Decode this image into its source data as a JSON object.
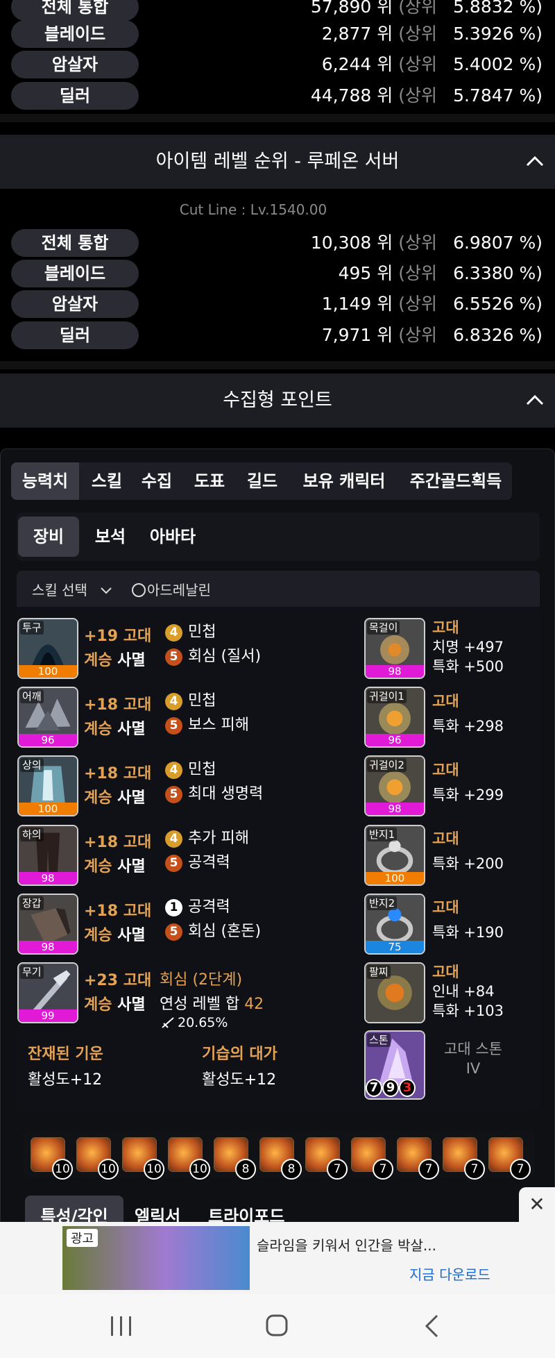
{
  "top_ranks": [
    {
      "label": "전체 통합",
      "rank": "57,890 위",
      "sang": "(상위",
      "pct": "5.8832 %)"
    },
    {
      "label": "블레이드",
      "rank": "2,877 위",
      "sang": "(상위",
      "pct": "5.3926 %)"
    },
    {
      "label": "암살자",
      "rank": "6,244 위",
      "sang": "(상위",
      "pct": "5.4002 %)"
    },
    {
      "label": "딜러",
      "rank": "44,788 위",
      "sang": "(상위",
      "pct": "5.7847 %)"
    }
  ],
  "item_level_section": {
    "title": "아이템 레벨 순위 - 루페온 서버",
    "cutline": "Cut Line : Lv.1540.00"
  },
  "item_ranks": [
    {
      "label": "전체 통합",
      "rank": "10,308 위",
      "sang": "(상위",
      "pct": "6.9807 %)"
    },
    {
      "label": "블레이드",
      "rank": "495 위",
      "sang": "(상위",
      "pct": "6.3380 %)"
    },
    {
      "label": "암살자",
      "rank": "1,149 위",
      "sang": "(상위",
      "pct": "6.5526 %)"
    },
    {
      "label": "딜러",
      "rank": "7,971 위",
      "sang": "(상위",
      "pct": "6.8326 %)"
    }
  ],
  "collect_section": {
    "title": "수집형 포인트"
  },
  "tabs": [
    "능력치",
    "스킬",
    "수집",
    "도표",
    "길드",
    "보유 캐릭터",
    "주간골드획득"
  ],
  "subtabs": [
    "장비",
    "보석",
    "아바타"
  ],
  "skill_select": {
    "label": "스킬 선택",
    "option": "아드레날린"
  },
  "equipment": [
    {
      "slot": "투구",
      "quality": "100",
      "qcolor": "#f07d00",
      "upgrade": "+19 고대",
      "set": "계승",
      "setname": "사멸",
      "eng1_lv": "4",
      "eng1": "민첩",
      "eng2_lv": "5",
      "eng2": "회심 (질서)"
    },
    {
      "slot": "어깨",
      "quality": "96",
      "qcolor": "#e01ad6",
      "upgrade": "+18 고대",
      "set": "계승",
      "setname": "사멸",
      "eng1_lv": "4",
      "eng1": "민첩",
      "eng2_lv": "5",
      "eng2": "보스 피해"
    },
    {
      "slot": "상의",
      "quality": "100",
      "qcolor": "#f07d00",
      "upgrade": "+18 고대",
      "set": "계승",
      "setname": "사멸",
      "eng1_lv": "4",
      "eng1": "민첩",
      "eng2_lv": "5",
      "eng2": "최대 생명력"
    },
    {
      "slot": "하의",
      "quality": "98",
      "qcolor": "#e01ad6",
      "upgrade": "+18 고대",
      "set": "계승",
      "setname": "사멸",
      "eng1_lv": "4",
      "eng1": "추가 피해",
      "eng2_lv": "5",
      "eng2": "공격력"
    },
    {
      "slot": "장갑",
      "quality": "98",
      "qcolor": "#e01ad6",
      "upgrade": "+18 고대",
      "set": "계승",
      "setname": "사멸",
      "eng1_lv": "1",
      "eng1": "공격력",
      "eng2_lv": "5",
      "eng2": "회심 (혼돈)"
    }
  ],
  "weapon": {
    "slot": "무기",
    "quality": "99",
    "upgrade": "+23 고대",
    "set": "계승",
    "setname": "사멸",
    "effect": "회심 (2단계)",
    "bond_label": "연성 레벨 합",
    "bond_value": "42",
    "dmg": "20.65%"
  },
  "set_effects": [
    {
      "name": "잔재된 기운",
      "value": "활성도+12"
    },
    {
      "name": "기습의 대가",
      "value": "활성도+12"
    }
  ],
  "accessories": [
    {
      "slot": "목걸이",
      "quality": "98",
      "qcolor": "#e01ad6",
      "grade": "고대",
      "lines": [
        "치명 +497",
        "특화 +500"
      ]
    },
    {
      "slot": "귀걸이1",
      "quality": "96",
      "qcolor": "#e01ad6",
      "grade": "고대",
      "lines": [
        "특화 +298"
      ]
    },
    {
      "slot": "귀걸이2",
      "quality": "98",
      "qcolor": "#e01ad6",
      "grade": "고대",
      "lines": [
        "특화 +299"
      ]
    },
    {
      "slot": "반지1",
      "quality": "100",
      "qcolor": "#f07d00",
      "grade": "고대",
      "lines": [
        "특화 +200"
      ]
    },
    {
      "slot": "반지2",
      "quality": "75",
      "qcolor": "#1a86e0",
      "grade": "고대",
      "lines": [
        "특화 +190"
      ]
    },
    {
      "slot": "팔찌",
      "quality": "",
      "qcolor": "",
      "grade": "고대",
      "lines": [
        "인내 +84",
        "특화 +103"
      ]
    }
  ],
  "stone": {
    "slot": "스톤",
    "name": "고대 스톤",
    "tier": "IV",
    "n1": "7",
    "n2": "9",
    "n3": "3"
  },
  "gems": [
    "10",
    "10",
    "10",
    "10",
    "8",
    "8",
    "7",
    "7",
    "7",
    "7",
    "7"
  ],
  "bottom_tabs": [
    "특성/각인",
    "엘릭서",
    "트라이포드"
  ],
  "ad": {
    "badge": "광고",
    "text": "슬라임을 키워서 인간을 박살...",
    "cta": "지금 다운로드",
    "close": "✕"
  },
  "colors": {
    "accent": "#e3a254",
    "bg": "#000000",
    "panel": "#1d1e24"
  }
}
